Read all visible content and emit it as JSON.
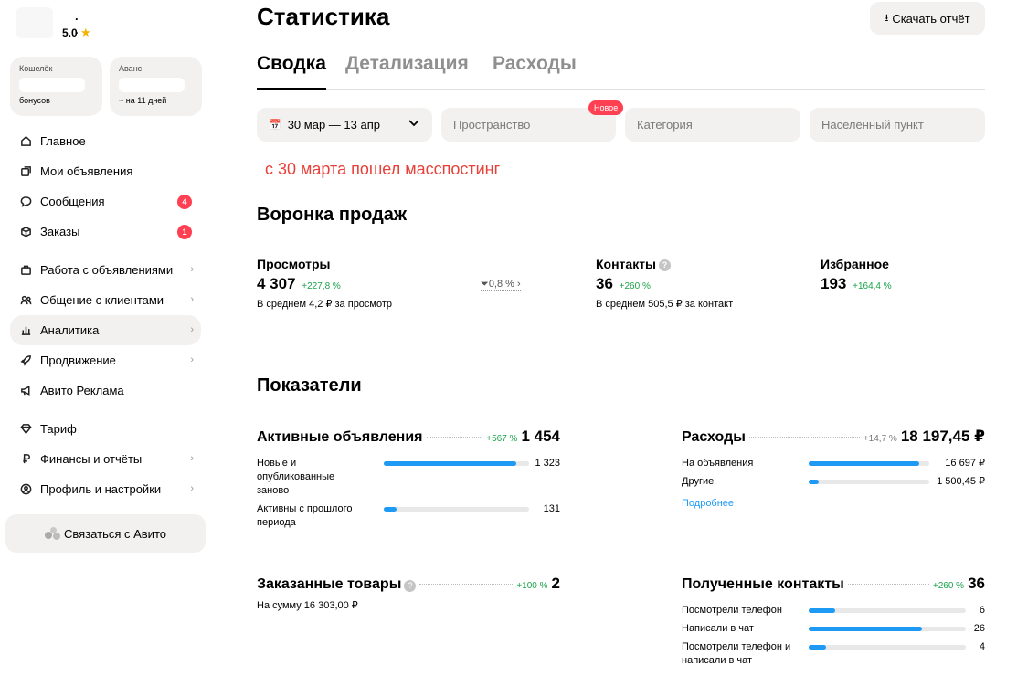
{
  "sidebar": {
    "profile": {
      "name": ". .",
      "rating": "5.0"
    },
    "wallet": {
      "title": "Кошелёк",
      "sub": "бонусов"
    },
    "advance": {
      "title": "Аванс",
      "sub": "~ на 11 дней"
    },
    "nav": [
      {
        "label": "Главное",
        "icon": "home-icon"
      },
      {
        "label": "Мои объявления",
        "icon": "listings-icon"
      },
      {
        "label": "Сообщения",
        "icon": "chat-icon",
        "badge": "4"
      },
      {
        "label": "Заказы",
        "icon": "box-icon",
        "badge": "1"
      },
      {
        "label": "Работа с объявлениями",
        "icon": "briefcase-icon"
      },
      {
        "label": "Общение с клиентами",
        "icon": "people-icon"
      },
      {
        "label": "Аналитика",
        "icon": "chart-icon"
      },
      {
        "label": "Продвижение",
        "icon": "rocket-icon"
      },
      {
        "label": "Авито Реклама",
        "icon": "megaphone-icon"
      },
      {
        "label": "Тариф",
        "icon": "diamond-icon"
      },
      {
        "label": "Финансы и отчёты",
        "icon": "ruble-icon"
      },
      {
        "label": "Профиль и настройки",
        "icon": "profile-icon"
      }
    ],
    "contact_button": "Связаться с Авито"
  },
  "header": {
    "title": "Статистика",
    "download_label": "Скачать отчёт"
  },
  "tabs": [
    {
      "label": "Сводка",
      "active": true
    },
    {
      "label": "Детализация",
      "active": false
    },
    {
      "label": "Расходы",
      "active": false
    }
  ],
  "filters": {
    "date_range": "30 мар — 13 апр",
    "space_placeholder": "Пространство",
    "new_badge": "Новое",
    "category_placeholder": "Категория",
    "city_placeholder": "Населённый пункт"
  },
  "note": "с 30 марта пошел масспостинг",
  "funnel": {
    "title": "Воронка продаж",
    "views": {
      "label": "Просмотры",
      "value": "4 307",
      "delta": "+227,8 %",
      "note": "В среднем 4,2 ₽ за просмотр"
    },
    "conversion": "0,8 %",
    "contacts": {
      "label": "Контакты",
      "value": "36",
      "delta": "+260 %",
      "note": "В среднем 505,5 ₽ за контакт"
    },
    "favorites": {
      "label": "Избранное",
      "value": "193",
      "delta": "+164,4 %"
    }
  },
  "metrics": {
    "title": "Показатели",
    "active_ads": {
      "name": "Активные объявления",
      "delta": "+567 %",
      "total": "1 454",
      "rows": [
        {
          "label": "Новые и опубликованные заново",
          "value": "1 323",
          "fill": 0.91
        },
        {
          "label": "Активны с прошлого периода",
          "value": "131",
          "fill": 0.09
        }
      ]
    },
    "expenses": {
      "name": "Расходы",
      "delta": "+14,7 %",
      "total": "18 197,45 ₽",
      "rows": [
        {
          "label": "На объявления",
          "value": "16 697 ₽",
          "fill": 0.92
        },
        {
          "label": "Другие",
          "value": "1 500,45 ₽",
          "fill": 0.08
        }
      ],
      "more": "Подробнее"
    },
    "ordered": {
      "name": "Заказанные товары",
      "delta": "+100 %",
      "total": "2",
      "sub": "На сумму 16 303,00 ₽"
    },
    "contacts_received": {
      "name": "Полученные контакты",
      "delta": "+260 %",
      "total": "36",
      "rows": [
        {
          "label": "Посмотрели телефон",
          "value": "6",
          "fill": 0.17
        },
        {
          "label": "Написали в чат",
          "value": "26",
          "fill": 0.72
        },
        {
          "label": "Посмотрели телефон и написали в чат",
          "value": "4",
          "fill": 0.11
        }
      ]
    }
  },
  "colors": {
    "accent": "#1e9af5",
    "positive": "#1aa34a",
    "badge": "#ff4053",
    "note": "#e8413a"
  }
}
